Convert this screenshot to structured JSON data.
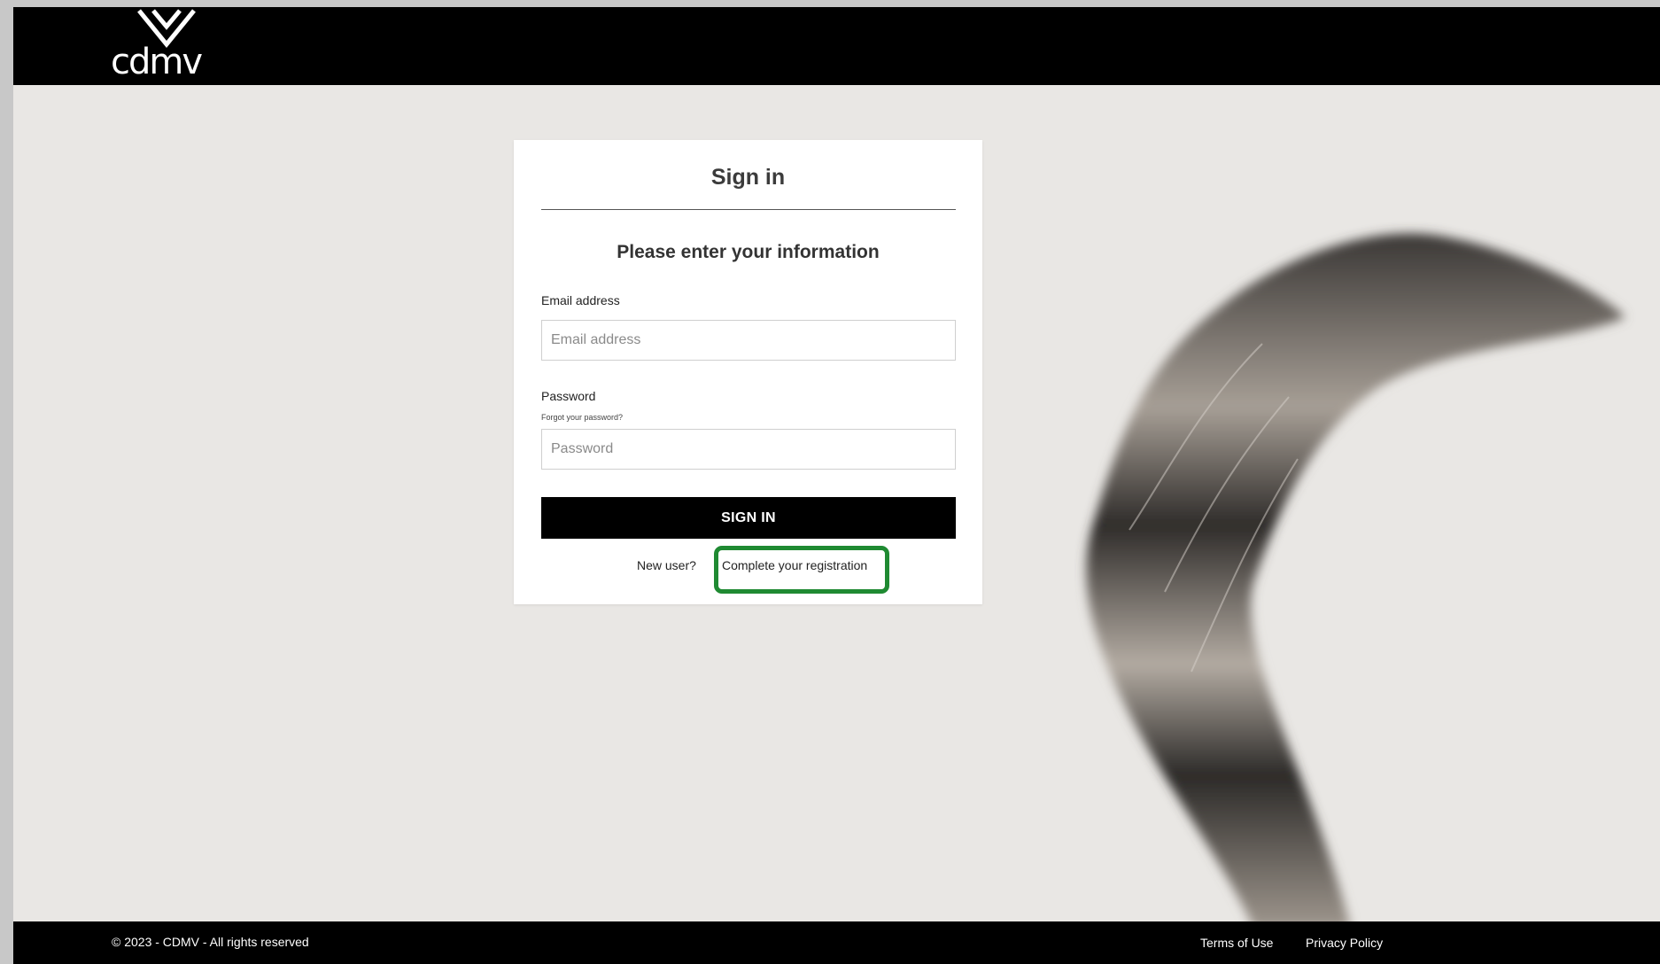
{
  "header": {
    "logo_text": "cdmv"
  },
  "signin_card": {
    "title": "Sign in",
    "subtitle": "Please enter your information",
    "email": {
      "label": "Email address",
      "placeholder": "Email address",
      "value": ""
    },
    "password": {
      "label": "Password",
      "forgot_link": "Forgot your password?",
      "placeholder": "Password",
      "value": ""
    },
    "submit_label": "SIGN IN",
    "new_user_text": "New user?",
    "register_link": "Complete your registration",
    "highlight_color": "#1f8a32"
  },
  "footer": {
    "copyright": "© 2023 - CDMV - All rights reserved",
    "links": [
      "Terms of Use",
      "Privacy Policy"
    ]
  }
}
